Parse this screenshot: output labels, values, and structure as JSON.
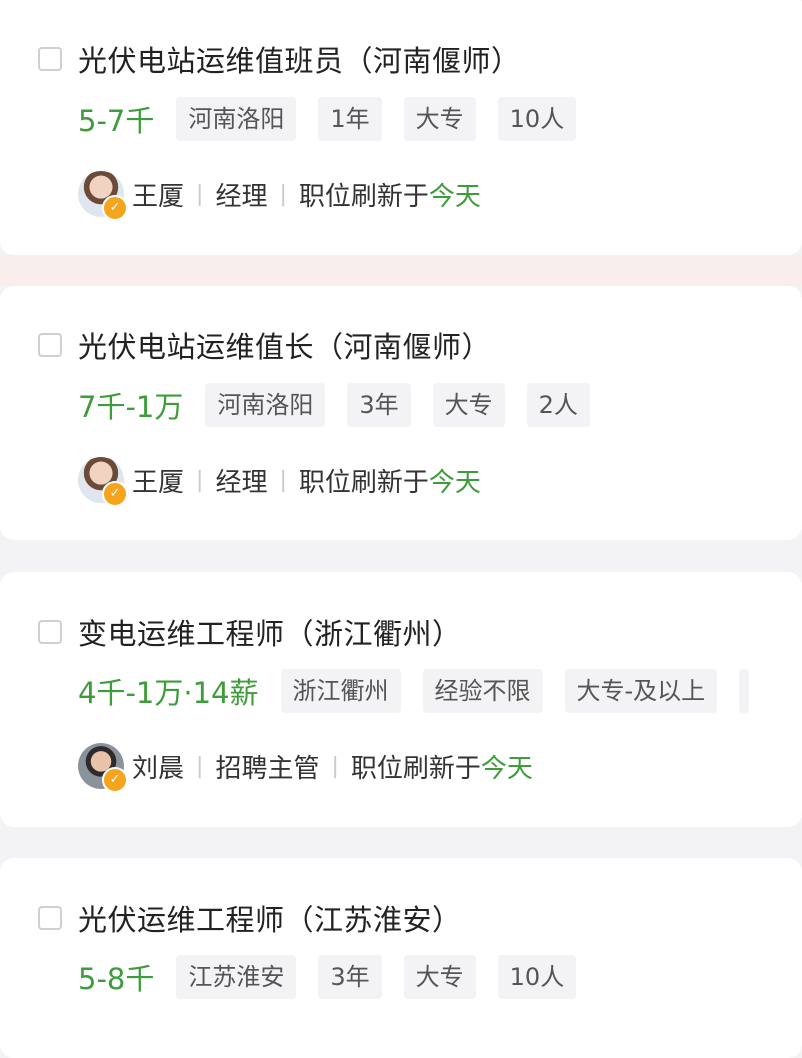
{
  "jobs": [
    {
      "title": "光伏电站运维值班员（河南偃师）",
      "salary": "5-7千",
      "tags": [
        "河南洛阳",
        "1年",
        "大专",
        "10人"
      ],
      "recruiter": {
        "name": "王厦",
        "role": "经理",
        "refresh_prefix": "职位刷新于",
        "refresh_time": "今天"
      }
    },
    {
      "title": "光伏电站运维值长（河南偃师）",
      "salary": "7千-1万",
      "tags": [
        "河南洛阳",
        "3年",
        "大专",
        "2人"
      ],
      "recruiter": {
        "name": "王厦",
        "role": "经理",
        "refresh_prefix": "职位刷新于",
        "refresh_time": "今天"
      }
    },
    {
      "title": "变电运维工程师（浙江衢州）",
      "salary": "4千-1万·14薪",
      "tags": [
        "浙江衢州",
        "经验不限",
        "大专-及以上"
      ],
      "recruiter": {
        "name": "刘晨",
        "role": "招聘主管",
        "refresh_prefix": "职位刷新于",
        "refresh_time": "今天"
      }
    },
    {
      "title": "光伏运维工程师（江苏淮安）",
      "salary": "5-8千",
      "tags": [
        "江苏淮安",
        "3年",
        "大专",
        "10人"
      ]
    }
  ],
  "badge_icon": "verified-badge-icon",
  "colors": {
    "salary": "#3e9d3a",
    "tag_bg": "#f3f3f6",
    "badge": "#f4a51d"
  }
}
